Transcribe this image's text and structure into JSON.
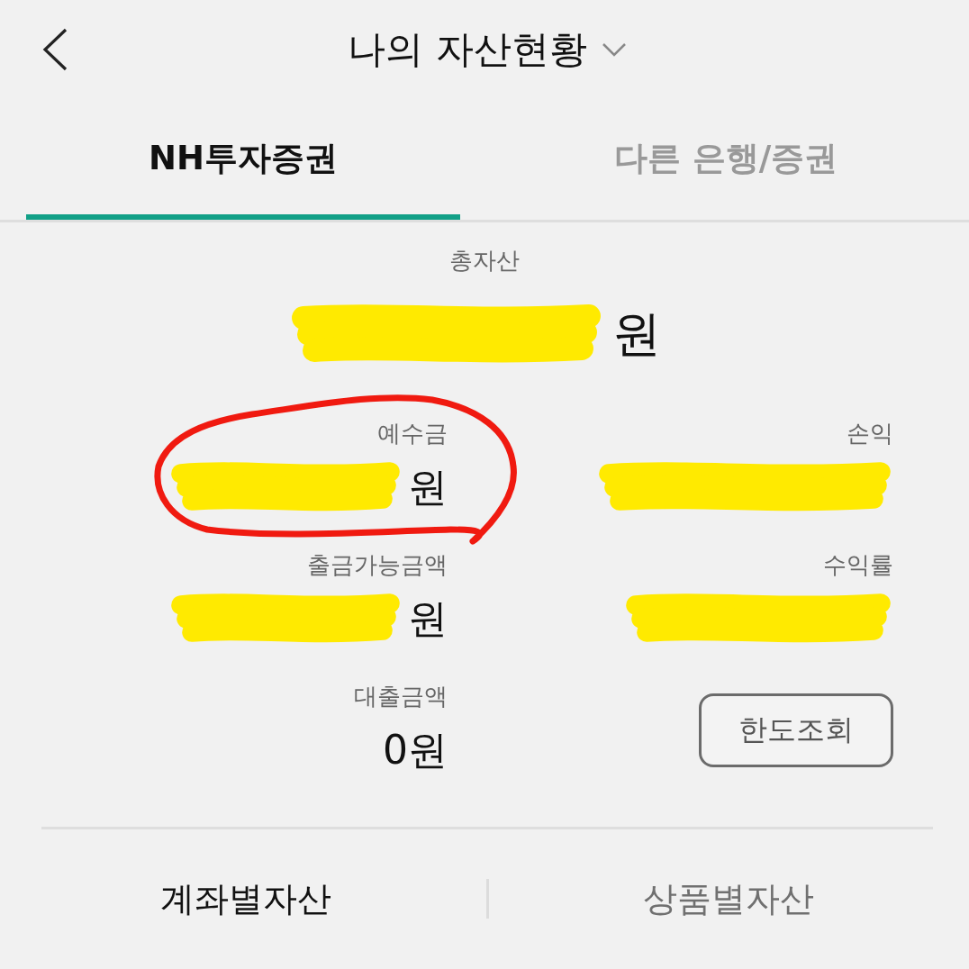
{
  "header": {
    "title": "나의 자산현황"
  },
  "tabs": [
    {
      "label": "NH투자증권",
      "selected": true
    },
    {
      "label": "다른 은행/증권",
      "selected": false
    }
  ],
  "total": {
    "label": "총자산",
    "value": "원",
    "redacted": true
  },
  "rows": [
    {
      "left": {
        "kind": "figure",
        "label": "예수금",
        "value": "원",
        "redacted": true,
        "circled": true
      },
      "right": {
        "kind": "figure",
        "label": "손익",
        "redacted": true,
        "circled": false
      }
    },
    {
      "left": {
        "kind": "figure",
        "label": "출금가능금액",
        "value": "원",
        "redacted": true,
        "circled": false
      },
      "right": {
        "kind": "figure",
        "label": "수익률",
        "redacted": true,
        "circled": false
      }
    },
    {
      "left": {
        "kind": "figure",
        "label": "대출금액",
        "value": "0원",
        "redacted": false,
        "circled": false
      },
      "right": {
        "kind": "button",
        "label": "한도조회"
      }
    }
  ],
  "bottom_tabs": [
    {
      "label": "계좌별자산",
      "selected": true
    },
    {
      "label": "상품별자산",
      "selected": false
    }
  ]
}
